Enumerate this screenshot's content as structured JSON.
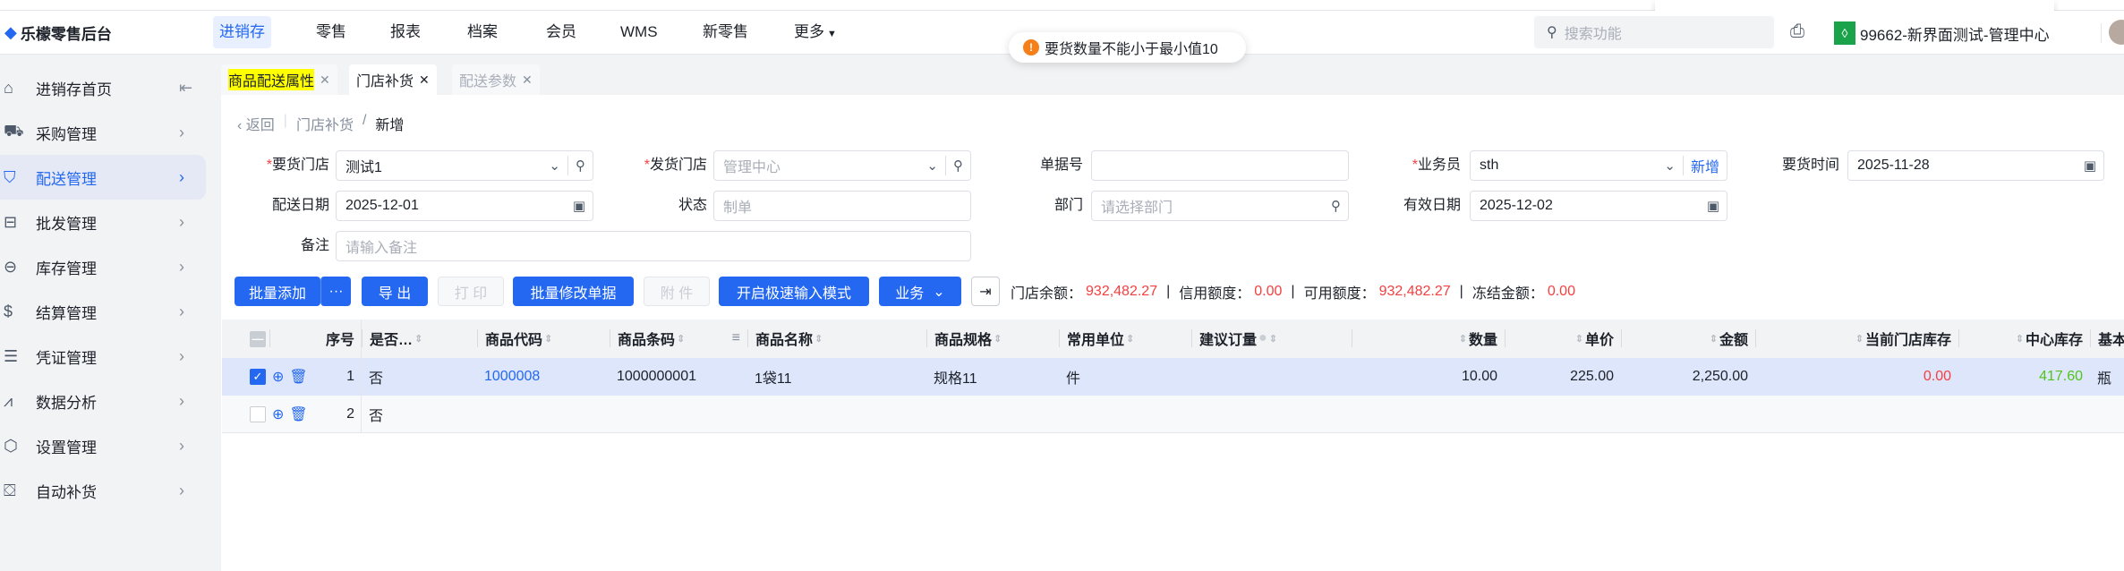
{
  "app": {
    "title": "乐檬零售后台"
  },
  "nav": {
    "items": [
      "进销存",
      "零售",
      "报表",
      "档案",
      "会员",
      "WMS",
      "新零售",
      "更多"
    ],
    "active": "进销存"
  },
  "toast": {
    "text": "要货数量不能小于最小值10"
  },
  "header": {
    "search_placeholder": "搜索功能",
    "store": "99662-新界面测试-管理中心"
  },
  "sidebar": {
    "items": [
      {
        "label": "进销存首页",
        "icon": "home-icon"
      },
      {
        "label": "采购管理",
        "icon": "cart-icon"
      },
      {
        "label": "配送管理",
        "icon": "map-icon"
      },
      {
        "label": "批发管理",
        "icon": "wholesale-icon"
      },
      {
        "label": "库存管理",
        "icon": "inventory-icon"
      },
      {
        "label": "结算管理",
        "icon": "dollar-icon"
      },
      {
        "label": "凭证管理",
        "icon": "document-icon"
      },
      {
        "label": "数据分析",
        "icon": "chart-icon"
      },
      {
        "label": "设置管理",
        "icon": "settings-icon"
      },
      {
        "label": "自动补货",
        "icon": "replenish-icon"
      }
    ]
  },
  "tabs": [
    {
      "label": "商品配送属性"
    },
    {
      "label": "门店补货"
    },
    {
      "label": "配送参数"
    }
  ],
  "breadcrumb": {
    "back": "返回",
    "path": "门店补货",
    "current": "新增"
  },
  "form": {
    "request_store": {
      "label": "要货门店",
      "value": "测试1"
    },
    "ship_store": {
      "label": "发货门店",
      "placeholder": "管理中心"
    },
    "doc_no": {
      "label": "单据号",
      "value": ""
    },
    "salesman": {
      "label": "业务员",
      "value": "sth",
      "add": "新增"
    },
    "request_time": {
      "label": "要货时间",
      "value": "2025-11-28"
    },
    "delivery_date": {
      "label": "配送日期",
      "value": "2025-12-01"
    },
    "status": {
      "label": "状态",
      "placeholder": "制单"
    },
    "department": {
      "label": "部门",
      "placeholder": "请选择部门"
    },
    "valid_date": {
      "label": "有效日期",
      "value": "2025-12-02"
    },
    "remark": {
      "label": "备注",
      "placeholder": "请输入备注"
    }
  },
  "toolbar": {
    "batch_add": "批量添加",
    "more": "···",
    "export": "导 出",
    "print": "打 印",
    "batch_edit": "批量修改单据",
    "attach": "附 件",
    "fast_mode": "开启极速输入模式",
    "business": "业务"
  },
  "money": {
    "store_balance_label": "门店余额：",
    "store_balance": "932,482.27",
    "credit_label": "信用额度：",
    "credit": "0.00",
    "available_label": "可用额度：",
    "available": "932,482.27",
    "frozen_label": "冻结金额：",
    "frozen": "0.00"
  },
  "table": {
    "headers": [
      "序号",
      "是否…",
      "商品代码",
      "商品条码",
      "商品名称",
      "商品规格",
      "常用单位",
      "建议订量",
      "数量",
      "单价",
      "金额",
      "当前门店库存",
      "中心库存",
      "基本"
    ],
    "rows": [
      {
        "checked": true,
        "seq": "1",
        "flag": "否",
        "code": "1000008",
        "barcode": "1000000001",
        "name": "1袋11",
        "spec": "规格11",
        "unit": "件",
        "suggest": "",
        "qty": "10.00",
        "price": "225.00",
        "amount": "2,250.00",
        "store_stock": "0.00",
        "center_stock": "417.60",
        "base": "瓶"
      },
      {
        "checked": false,
        "seq": "2",
        "flag": "否",
        "code": "",
        "barcode": "",
        "name": "",
        "spec": "",
        "unit": "",
        "suggest": "",
        "qty": "",
        "price": "",
        "amount": "",
        "store_stock": "",
        "center_stock": "",
        "base": ""
      }
    ]
  },
  "colors": {
    "primary": "#2468f2",
    "danger": "#f53f3f",
    "success": "#52c41a",
    "selected_row": "#dde6fb"
  }
}
